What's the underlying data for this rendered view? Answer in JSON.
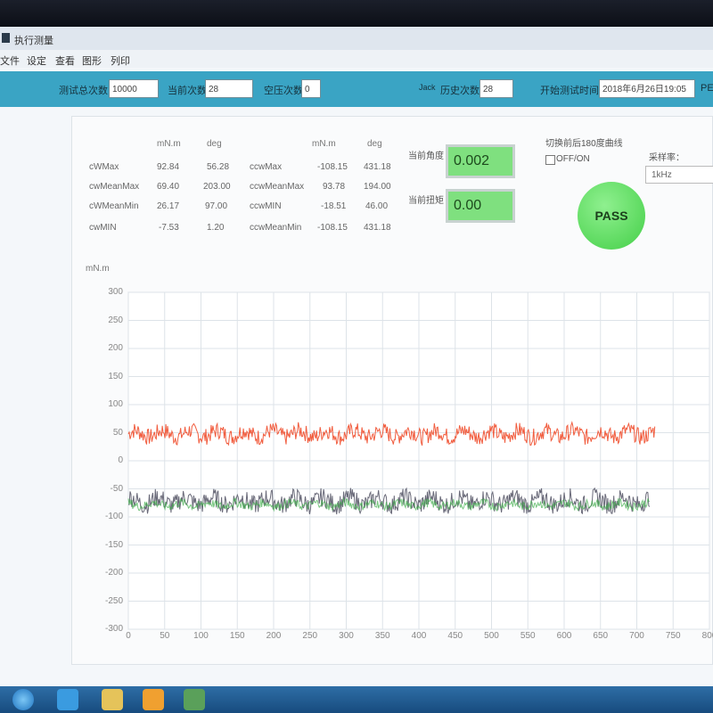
{
  "window": {
    "title": "执行测量"
  },
  "menu": [
    "文件",
    "设定",
    "查看",
    "图形",
    "列印"
  ],
  "toolbar": {
    "test_count_label": "测试总次数",
    "test_count_value": "10000",
    "current_count_label": "当前次数",
    "current_count_value": "28",
    "idle_count_label": "空压次数",
    "idle_count_value": "0",
    "history_prefix": "Jack",
    "history_label": "历史次数",
    "history_value": "28",
    "start_time_label": "开始测试时间",
    "start_time_value": "2018年6月26日19:05",
    "right_cut": "PED"
  },
  "stats": {
    "unit_headers": [
      "mN.m",
      "deg",
      "mN.m",
      "deg"
    ],
    "rows": [
      {
        "left_label": "cWMax",
        "left_val": "92.84",
        "left_deg": "56.28",
        "right_label": "ccwMax",
        "right_val": "-108.15",
        "right_deg": "431.18"
      },
      {
        "left_label": "cwMeanMax",
        "left_val": "69.40",
        "left_deg": "203.00",
        "right_label": "ccwMeanMax",
        "right_val": "93.78",
        "right_deg": "194.00"
      },
      {
        "left_label": "cWMeanMin",
        "left_val": "26.17",
        "left_deg": "97.00",
        "right_label": "ccwMIN",
        "right_val": "-18.51",
        "right_deg": "46.00"
      },
      {
        "left_label": "cwMIN",
        "left_val": "-7.53",
        "left_deg": "1.20",
        "right_label": "ccwMeanMin",
        "right_val": "-108.15",
        "right_deg": "431.18"
      }
    ]
  },
  "current": {
    "angle_label": "当前角度",
    "angle_value": "0.002",
    "torque_label": "当前扭矩",
    "torque_value": "0.00"
  },
  "curve_toggle": {
    "label": "切换前后180度曲线",
    "option": "OFF/ON"
  },
  "sampling": {
    "label": "采样率：",
    "value": "1kHz"
  },
  "result": {
    "label": "PASS",
    "color": "#4fd152"
  },
  "chart_data": {
    "type": "line",
    "ylabel": "mN.m",
    "ylim": [
      -300,
      300
    ],
    "xlim": [
      0,
      800
    ],
    "y_ticks": [
      300,
      250,
      200,
      150,
      100,
      50,
      0,
      -50,
      -100,
      -150,
      -200,
      -250,
      -300
    ],
    "x_ticks": [
      0,
      50,
      100,
      150,
      200,
      250,
      300,
      350,
      400,
      450,
      500,
      550,
      600,
      650,
      700,
      750,
      800
    ],
    "x_range_data": [
      0,
      725
    ],
    "grid": true,
    "series": [
      {
        "color": "#f04b2a",
        "mean": 48,
        "amplitude": 15,
        "x_start": 0,
        "x_end": 725
      },
      {
        "color": "#5a5a6a",
        "mean": -72,
        "amplitude": 17,
        "x_start": 0,
        "x_end": 718
      },
      {
        "color": "#3fae4a",
        "mean": -78,
        "amplitude": 8,
        "x_start": 0,
        "x_end": 718
      }
    ]
  },
  "taskbar": {
    "items": [
      {
        "name": "start-button",
        "color": "#1e73c0"
      },
      {
        "name": "browser-icon",
        "color": "#3a9be0"
      },
      {
        "name": "folder-icon",
        "color": "#e5c35a"
      },
      {
        "name": "media-icon",
        "color": "#f0a030"
      },
      {
        "name": "app-icon",
        "color": "#5aa05a"
      }
    ]
  }
}
